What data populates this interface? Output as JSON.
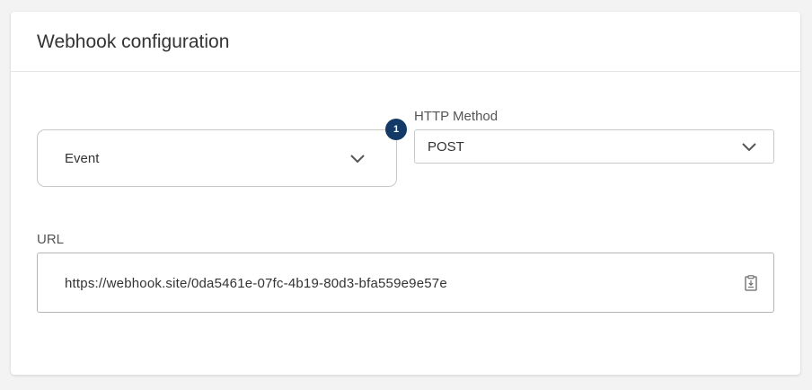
{
  "card": {
    "title": "Webhook configuration"
  },
  "event_select": {
    "value": "Event",
    "badge": "1"
  },
  "http_method": {
    "label": "HTTP Method",
    "value": "POST"
  },
  "url": {
    "label": "URL",
    "value": "https://webhook.site/0da5461e-07fc-4b19-80d3-bfa559e9e57e"
  },
  "icons": {
    "dropdown": "chevron-down-icon",
    "copy": "clipboard-icon"
  },
  "colors": {
    "badge": "#133a67",
    "background": "#f3f3f4",
    "card": "#ffffff"
  }
}
